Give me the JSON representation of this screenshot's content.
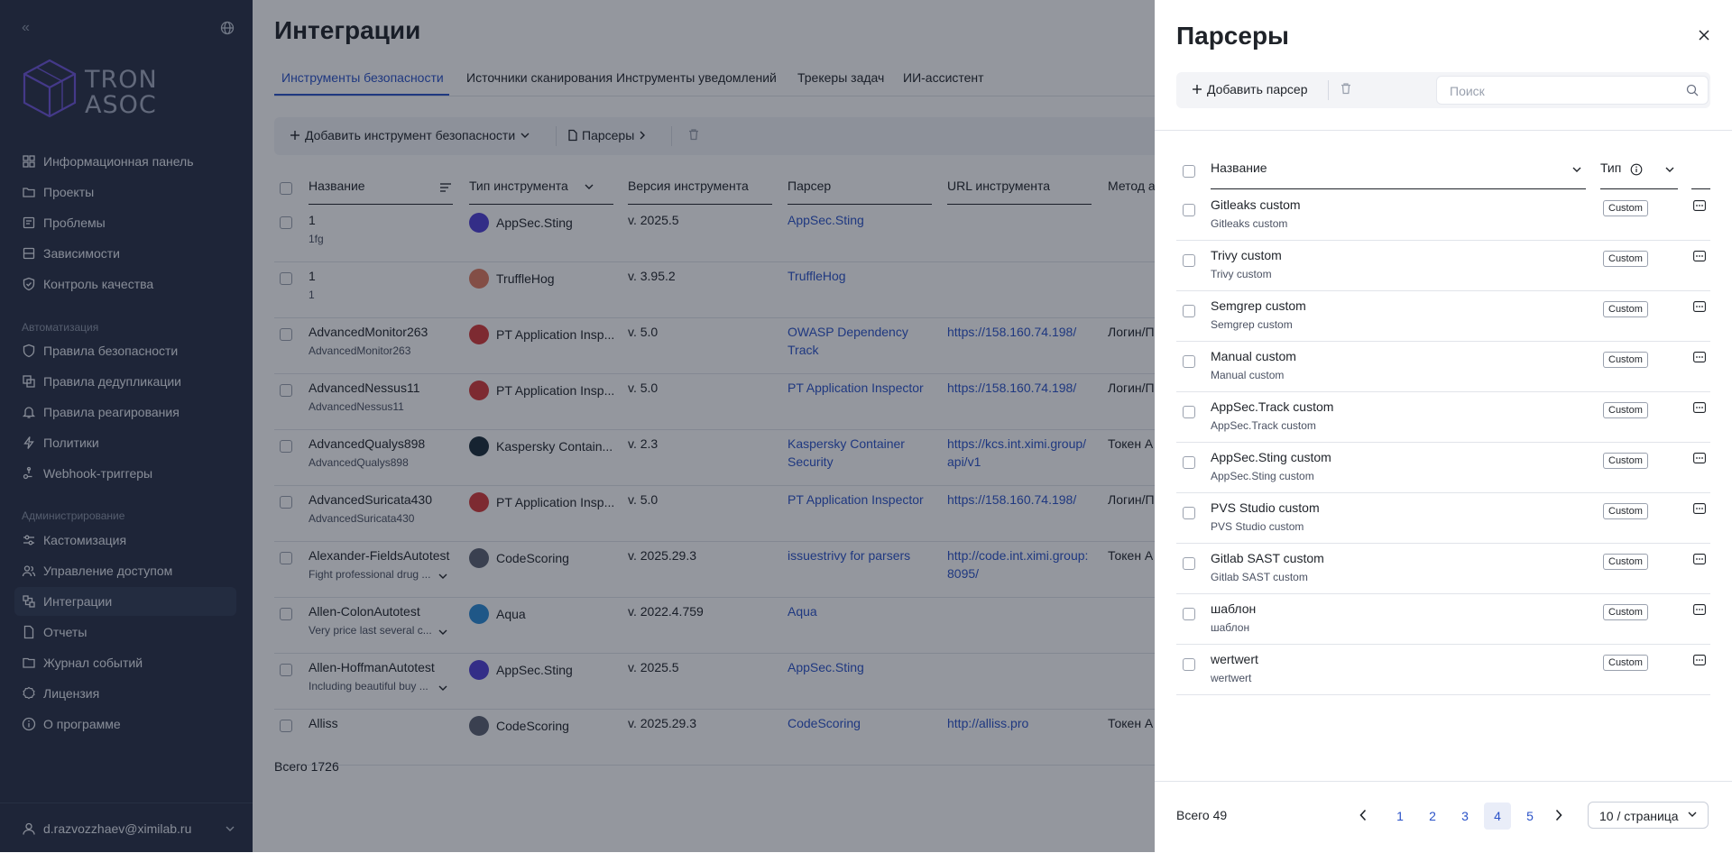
{
  "sidebar": {
    "logo": {
      "line1": "TRON",
      "line2": "ASOC"
    },
    "items_main": [
      {
        "label": "Информационная панель",
        "icon": "dashboard-icon"
      },
      {
        "label": "Проекты",
        "icon": "folder-icon"
      },
      {
        "label": "Проблемы",
        "icon": "bug-icon"
      },
      {
        "label": "Зависимости",
        "icon": "dependencies-icon"
      },
      {
        "label": "Контроль качества",
        "icon": "quality-icon"
      }
    ],
    "section_automation": "Автоматизация",
    "items_automation": [
      {
        "label": "Правила безопасности",
        "icon": "shield-icon"
      },
      {
        "label": "Правила дедупликации",
        "icon": "deduplication-icon"
      },
      {
        "label": "Правила реагирования",
        "icon": "bell-icon"
      },
      {
        "label": "Политики",
        "icon": "lightning-icon"
      },
      {
        "label": "Webhook-триггеры",
        "icon": "webhook-icon"
      }
    ],
    "section_admin": "Администрирование",
    "items_admin": [
      {
        "label": "Кастомизация",
        "icon": "sliders-icon"
      },
      {
        "label": "Управление доступом",
        "icon": "users-icon"
      },
      {
        "label": "Интеграции",
        "icon": "integrations-icon"
      },
      {
        "label": "Отчеты",
        "icon": "report-icon"
      },
      {
        "label": "Журнал событий",
        "icon": "event-log-icon"
      },
      {
        "label": "Лицензия",
        "icon": "license-icon"
      },
      {
        "label": "О программе",
        "icon": "info-icon"
      }
    ],
    "user": "d.razvozzhaev@ximilab.ru"
  },
  "main": {
    "title": "Интеграции",
    "tabs": [
      "Инструменты безопасности",
      "Источники сканирования",
      "Инструменты уведомлений",
      "Трекеры задач",
      "ИИ-ассистент"
    ],
    "toolbar": {
      "add": "Добавить инструмент безопасности",
      "parsers": "Парсеры"
    },
    "columns": [
      "Название",
      "Тип инструмента",
      "Версия инструмента",
      "Парсер",
      "URL инструмента",
      "Метод а"
    ],
    "rows": [
      {
        "name": "1",
        "sub": "1fg",
        "tool": "AppSec.Sting",
        "tool_color": "#4f3fd6",
        "version": "v. 2025.5",
        "parser": "AppSec.Sting",
        "parser2": "",
        "url": "",
        "url2": "",
        "method": ""
      },
      {
        "name": "1",
        "sub": "1",
        "tool": "TruffleHog",
        "tool_color": "#e07a5f",
        "version": "v. 3.95.2",
        "parser": "TruffleHog",
        "parser2": "",
        "url": "",
        "url2": "",
        "method": ""
      },
      {
        "name": "AdvancedMonitor263",
        "sub": "AdvancedMonitor263",
        "tool": "PT Application Insp...",
        "tool_color": "#d63a3a",
        "version": "v. 5.0",
        "parser": "OWASP Dependency",
        "parser2": "Track",
        "url": "https://158.160.74.198/",
        "url2": "",
        "method": "Логин/П"
      },
      {
        "name": "AdvancedNessus11",
        "sub": "AdvancedNessus11",
        "tool": "PT Application Insp...",
        "tool_color": "#d63a3a",
        "version": "v. 5.0",
        "parser": "PT Application Inspector",
        "parser2": "",
        "url": "https://158.160.74.198/",
        "url2": "",
        "method": "Логин/П"
      },
      {
        "name": "AdvancedQualys898",
        "sub": "AdvancedQualys898",
        "tool": "Kaspersky Contain...",
        "tool_color": "#1b2d3a",
        "version": "v. 2.3",
        "parser": "Kaspersky Container",
        "parser2": "Security",
        "url": "https://kcs.int.ximi.group/",
        "url2": "api/v1",
        "method": "Токен А"
      },
      {
        "name": "AdvancedSuricata430",
        "sub": "AdvancedSuricata430",
        "tool": "PT Application Insp...",
        "tool_color": "#d63a3a",
        "version": "v. 5.0",
        "parser": "PT Application Inspector",
        "parser2": "",
        "url": "https://158.160.74.198/",
        "url2": "",
        "method": "Логин/П"
      },
      {
        "name": "Alexander-FieldsAutotest",
        "sub": "Fight professional drug ...",
        "tool": "CodeScoring",
        "tool_color": "#5b6272",
        "version": "v. 2025.29.3",
        "parser": "issuestrivy for parsers",
        "parser2": "",
        "url": "http://code.int.ximi.group:",
        "url2": "8095/",
        "method": "Токен А"
      },
      {
        "name": "Allen-ColonAutotest",
        "sub": "Very price last several c...",
        "tool": "Aqua",
        "tool_color": "#2a8bd6",
        "version": "v. 2022.4.759",
        "parser": "Aqua",
        "parser2": "",
        "url": "",
        "url2": "",
        "method": ""
      },
      {
        "name": "Allen-HoffmanAutotest",
        "sub": "Including beautiful buy ...",
        "tool": "AppSec.Sting",
        "tool_color": "#4f3fd6",
        "version": "v. 2025.5",
        "parser": "AppSec.Sting",
        "parser2": "",
        "url": "",
        "url2": "",
        "method": ""
      },
      {
        "name": "Alliss",
        "sub": "",
        "tool": "CodeScoring",
        "tool_color": "#5b6272",
        "version": "v. 2025.29.3",
        "parser": "CodeScoring",
        "parser2": "",
        "url": "http://alliss.pro",
        "url2": "",
        "method": "Токен А"
      }
    ],
    "total": "Всего 1726"
  },
  "drawer": {
    "title": "Парсеры",
    "add": "Добавить парсер",
    "search_placeholder": "Поиск",
    "col_name": "Название",
    "col_type": "Тип",
    "rows": [
      {
        "name": "Gitleaks custom",
        "sub": "Gitleaks custom",
        "type": "Custom"
      },
      {
        "name": "Trivy custom",
        "sub": "Trivy custom",
        "type": "Custom"
      },
      {
        "name": "Semgrep custom",
        "sub": "Semgrep custom",
        "type": "Custom"
      },
      {
        "name": "Manual custom",
        "sub": "Manual custom",
        "type": "Custom"
      },
      {
        "name": "AppSec.Track custom",
        "sub": "AppSec.Track custom",
        "type": "Custom"
      },
      {
        "name": "AppSec.Sting custom",
        "sub": "AppSec.Sting custom",
        "type": "Custom"
      },
      {
        "name": "PVS Studio custom",
        "sub": "PVS Studio custom",
        "type": "Custom"
      },
      {
        "name": "Gitlab SAST custom",
        "sub": "Gitlab SAST custom",
        "type": "Custom"
      },
      {
        "name": "шаблон",
        "sub": "шаблон",
        "type": "Custom"
      },
      {
        "name": "wertwert",
        "sub": "wertwert",
        "type": "Custom"
      }
    ],
    "total": "Всего 49",
    "pages": [
      "1",
      "2",
      "3",
      "4",
      "5"
    ],
    "current_page": "4",
    "page_size": "10 / страница"
  }
}
